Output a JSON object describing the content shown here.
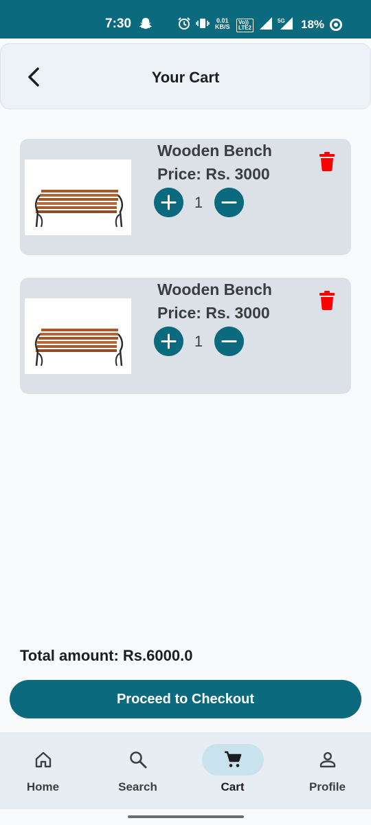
{
  "status_bar": {
    "time": "7:30",
    "net_speed_value": "0.01",
    "net_speed_unit": "KB/S",
    "volte_top": "Vo))",
    "volte_bottom": "LTE2",
    "network_label": "5G",
    "battery": "18%",
    "background": "#0b6a7e"
  },
  "app_bar": {
    "title": "Your Cart",
    "back_icon": "chevron-left-icon"
  },
  "cart": {
    "items": [
      {
        "name": "Wooden Bench",
        "price": "Price: Rs. 3000",
        "quantity": "1",
        "image": "wooden-bench-image"
      },
      {
        "name": "Wooden Bench",
        "price": "Price: Rs. 3000",
        "quantity": "1",
        "image": "wooden-bench-image"
      }
    ],
    "plus_icon": "plus-icon",
    "minus_icon": "minus-icon",
    "delete_icon": "trash-icon",
    "delete_color": "#ff0000"
  },
  "summary": {
    "total": "Total amount: Rs.6000.0",
    "checkout_label": "Proceed to Checkout"
  },
  "bottom_nav": {
    "items": [
      {
        "label": "Home",
        "icon": "home-icon",
        "active": false
      },
      {
        "label": "Search",
        "icon": "search-icon",
        "active": false
      },
      {
        "label": "Cart",
        "icon": "cart-icon",
        "active": true
      },
      {
        "label": "Profile",
        "icon": "profile-icon",
        "active": false
      }
    ]
  },
  "colors": {
    "accent": "#0b6a7e",
    "card_background": "#dbe1e6",
    "nav_active_pill": "#c9e3ee"
  }
}
